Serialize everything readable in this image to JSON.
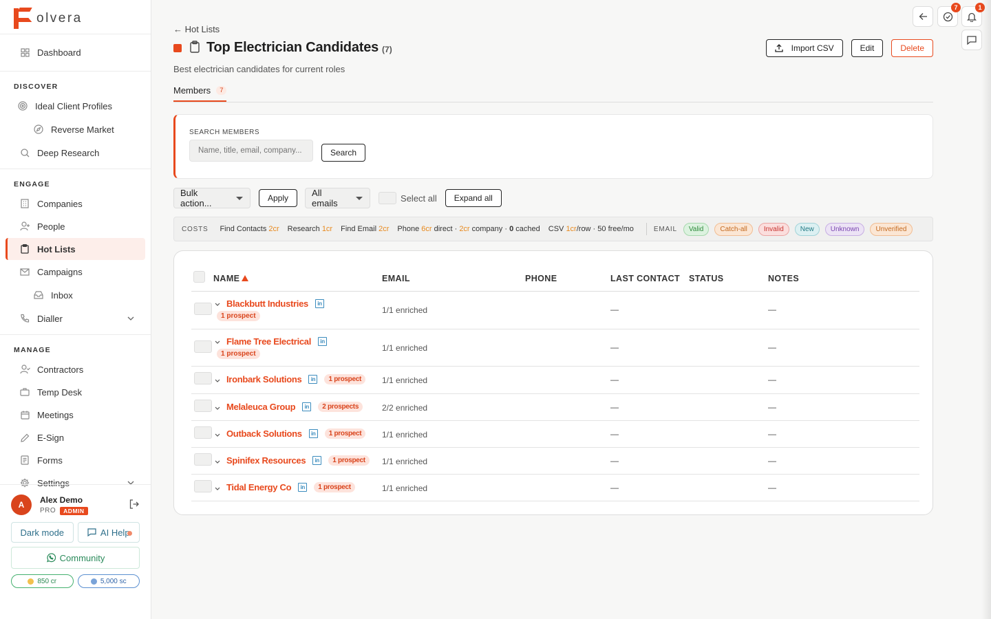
{
  "brand": {
    "name": "olvera"
  },
  "sidebar": {
    "dashboard": "Dashboard",
    "discover_label": "DISCOVER",
    "discover": [
      "Ideal Client Profiles",
      "Reverse Market",
      "Deep Research"
    ],
    "engage_label": "ENGAGE",
    "engage": [
      "Companies",
      "People",
      "Hot Lists",
      "Campaigns",
      "Inbox",
      "Dialler"
    ],
    "manage_label": "MANAGE",
    "manage": [
      "Contractors",
      "Temp Desk",
      "Meetings",
      "E-Sign",
      "Forms",
      "Settings"
    ]
  },
  "user": {
    "initial": "A",
    "name": "Alex Demo",
    "tier": "PRO",
    "role": "ADMIN",
    "dark_mode": "Dark mode",
    "ai_help": "AI Help",
    "community": "Community",
    "credits": "850 cr",
    "sc": "5,000 sc"
  },
  "header": {
    "back": "← Hot Lists",
    "title": "Top Electrician Candidates",
    "count": "(7)",
    "subtitle": "Best electrician candidates for current roles",
    "import": "Import CSV",
    "edit": "Edit",
    "delete": "Delete"
  },
  "tabs": {
    "members": "Members",
    "members_count": "7"
  },
  "search": {
    "label": "SEARCH MEMBERS",
    "placeholder": "Name, title, email, company...",
    "button": "Search"
  },
  "toolbar": {
    "bulk": "Bulk action...",
    "apply": "Apply",
    "emails": "All emails",
    "select_all": "Select all",
    "expand_all": "Expand all"
  },
  "costs": {
    "label": "COSTS",
    "find_contacts": "Find Contacts",
    "find_contacts_cr": "2cr",
    "research": "Research",
    "research_cr": "1cr",
    "find_email": "Find Email",
    "find_email_cr": "2cr",
    "phone": "Phone",
    "phone_direct_cr": "6cr",
    "phone_direct": "direct ·",
    "phone_company_cr": "2cr",
    "phone_company": "company ·",
    "phone_cached_n": "0",
    "phone_cached": "cached",
    "csv": "CSV",
    "csv_cr": "1cr",
    "csv_rest": "/row · 50 free/mo",
    "email_label": "EMAIL",
    "pills": [
      "Valid",
      "Catch-all",
      "Invalid",
      "New",
      "Unknown",
      "Unverified"
    ]
  },
  "table": {
    "headers": {
      "name": "NAME",
      "email": "EMAIL",
      "phone": "PHONE",
      "last_contact": "LAST CONTACT",
      "status": "STATUS",
      "notes": "NOTES"
    },
    "dash": "—",
    "rows": [
      {
        "name": "Blackbutt Industries",
        "prospects": "1 prospect",
        "email": "1/1 enriched"
      },
      {
        "name": "Flame Tree Electrical",
        "prospects": "1 prospect",
        "email": "1/1 enriched"
      },
      {
        "name": "Ironbark Solutions",
        "prospects": "1 prospect",
        "email": "1/1 enriched"
      },
      {
        "name": "Melaleuca Group",
        "prospects": "2 prospects",
        "email": "2/2 enriched"
      },
      {
        "name": "Outback Solutions",
        "prospects": "1 prospect",
        "email": "1/1 enriched"
      },
      {
        "name": "Spinifex Resources",
        "prospects": "1 prospect",
        "email": "1/1 enriched"
      },
      {
        "name": "Tidal Energy Co",
        "prospects": "1 prospect",
        "email": "1/1 enriched"
      }
    ]
  },
  "topbar": {
    "tasks_count": "7",
    "notif_count": "1"
  }
}
